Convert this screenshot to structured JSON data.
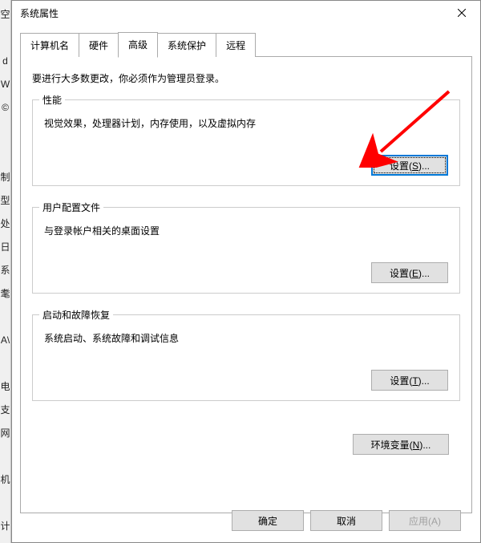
{
  "left_strip_chars": [
    "空",
    "",
    "d",
    "W",
    "©",
    "",
    "",
    "制",
    "型",
    "处",
    "日",
    "系",
    "耄",
    "",
    "A\\",
    "",
    "电",
    "支",
    "网",
    "",
    "机",
    "",
    "计"
  ],
  "dialog": {
    "title": "系统属性"
  },
  "tabs": [
    {
      "label": "计算机名",
      "active": false
    },
    {
      "label": "硬件",
      "active": false
    },
    {
      "label": "高级",
      "active": true
    },
    {
      "label": "系统保护",
      "active": false
    },
    {
      "label": "远程",
      "active": false
    }
  ],
  "panel": {
    "intro": "要进行大多数更改，你必须作为管理员登录。",
    "performance": {
      "legend": "性能",
      "desc": "视觉效果，处理器计划，内存使用，以及虚拟内存",
      "btn_prefix": "设置(",
      "btn_hotkey": "S",
      "btn_suffix": ")..."
    },
    "profiles": {
      "legend": "用户配置文件",
      "desc": "与登录帐户相关的桌面设置",
      "btn_prefix": "设置(",
      "btn_hotkey": "E",
      "btn_suffix": ")..."
    },
    "failure": {
      "legend": "启动和故障恢复",
      "desc": "系统启动、系统故障和调试信息",
      "btn_prefix": "设置(",
      "btn_hotkey": "T",
      "btn_suffix": ")..."
    },
    "env_btn_prefix": "环境变量(",
    "env_btn_hotkey": "N",
    "env_btn_suffix": ")..."
  },
  "footer": {
    "ok": "确定",
    "cancel": "取消",
    "apply": "应用(A)"
  }
}
